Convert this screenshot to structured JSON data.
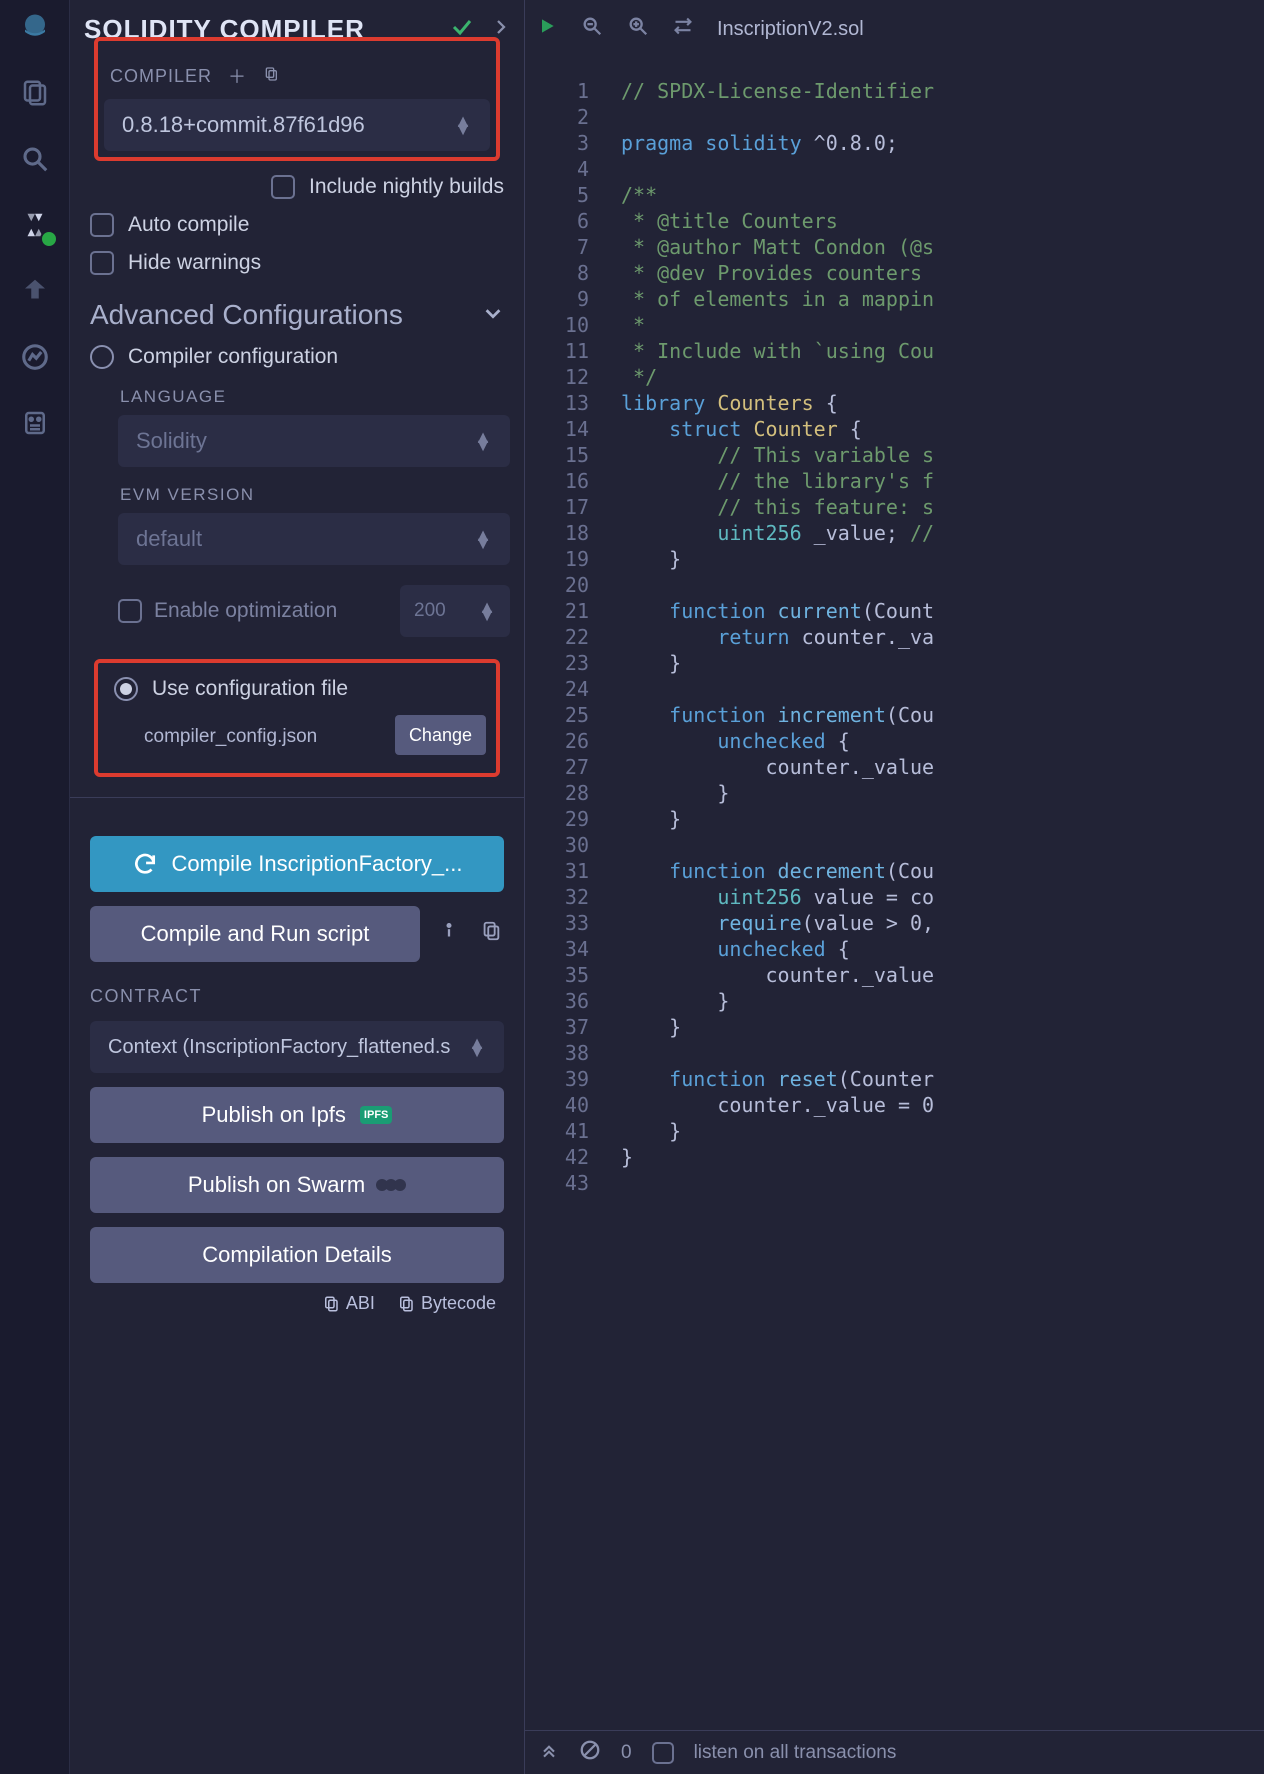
{
  "panel": {
    "title": "SOLIDITY COMPILER",
    "compiler_label": "COMPILER",
    "version": "0.8.18+commit.87f61d96",
    "include_nightly": "Include nightly builds",
    "auto_compile": "Auto compile",
    "hide_warnings": "Hide warnings",
    "advanced": "Advanced Configurations",
    "compiler_config": "Compiler configuration",
    "language_label": "LANGUAGE",
    "language_value": "Solidity",
    "evm_label": "EVM VERSION",
    "evm_value": "default",
    "enable_opt": "Enable optimization",
    "opt_runs": "200",
    "use_config": "Use configuration file",
    "config_file": "compiler_config.json",
    "change_btn": "Change",
    "compile_btn": "Compile InscriptionFactory_...",
    "compile_run_btn": "Compile and Run script",
    "contract_label": "CONTRACT",
    "contract_value": "Context (InscriptionFactory_flattened.s",
    "publish_ipfs": "Publish on Ipfs",
    "publish_swarm": "Publish on Swarm",
    "comp_details": "Compilation Details",
    "abi": "ABI",
    "bytecode": "Bytecode"
  },
  "editor": {
    "filename": "InscriptionV2.sol",
    "status_count": "0",
    "status_listen": "listen on all transactions",
    "lines": [
      {
        "n": 1,
        "h": "<span class='c-cm'>// SPDX-License-Identifier</span>"
      },
      {
        "n": 2,
        "h": ""
      },
      {
        "n": 3,
        "h": "<span class='c-kw'>pragma</span> <span class='c-kw'>solidity</span> ^0.8.0;"
      },
      {
        "n": 4,
        "h": ""
      },
      {
        "n": 5,
        "h": "<span class='c-cm'>/**</span>"
      },
      {
        "n": 6,
        "h": "<span class='c-cm'> * @title Counters</span>"
      },
      {
        "n": 7,
        "h": "<span class='c-cm'> * @author Matt Condon (@s</span>"
      },
      {
        "n": 8,
        "h": "<span class='c-cm'> * @dev Provides counters </span>"
      },
      {
        "n": 9,
        "h": "<span class='c-cm'> * of elements in a mappin</span>"
      },
      {
        "n": 10,
        "h": "<span class='c-cm'> *</span>"
      },
      {
        "n": 11,
        "h": "<span class='c-cm'> * Include with `using Cou</span>"
      },
      {
        "n": 12,
        "h": "<span class='c-cm'> */</span>"
      },
      {
        "n": 13,
        "h": "<span class='c-kw'>library</span> <span class='c-id'>Counters</span> {"
      },
      {
        "n": 14,
        "h": "    <span class='c-kw'>struct</span> <span class='c-id'>Counter</span> {"
      },
      {
        "n": 15,
        "h": "        <span class='c-cm'>// This variable s</span>"
      },
      {
        "n": 16,
        "h": "        <span class='c-cm'>// the library's f</span>"
      },
      {
        "n": 17,
        "h": "        <span class='c-cm'>// this feature: s</span>"
      },
      {
        "n": 18,
        "h": "        <span class='c-ty'>uint256</span> _value; <span class='c-cm'>//</span>"
      },
      {
        "n": 19,
        "h": "    }"
      },
      {
        "n": 20,
        "h": ""
      },
      {
        "n": 21,
        "h": "    <span class='c-kw'>function</span> <span class='c-fn'>current</span>(Count"
      },
      {
        "n": 22,
        "h": "        <span class='c-kw'>return</span> counter._va"
      },
      {
        "n": 23,
        "h": "    }"
      },
      {
        "n": 24,
        "h": ""
      },
      {
        "n": 25,
        "h": "    <span class='c-kw'>function</span> <span class='c-fn'>increment</span>(Cou"
      },
      {
        "n": 26,
        "h": "        <span class='c-kw'>unchecked</span> {"
      },
      {
        "n": 27,
        "h": "            counter._value"
      },
      {
        "n": 28,
        "h": "        }"
      },
      {
        "n": 29,
        "h": "    }"
      },
      {
        "n": 30,
        "h": ""
      },
      {
        "n": 31,
        "h": "    <span class='c-kw'>function</span> <span class='c-fn'>decrement</span>(Cou"
      },
      {
        "n": 32,
        "h": "        <span class='c-ty'>uint256</span> value = co"
      },
      {
        "n": 33,
        "h": "        <span class='c-fn'>require</span>(value &gt; 0,"
      },
      {
        "n": 34,
        "h": "        <span class='c-kw'>unchecked</span> {"
      },
      {
        "n": 35,
        "h": "            counter._value"
      },
      {
        "n": 36,
        "h": "        }"
      },
      {
        "n": 37,
        "h": "    }"
      },
      {
        "n": 38,
        "h": ""
      },
      {
        "n": 39,
        "h": "    <span class='c-kw'>function</span> <span class='c-fn'>reset</span>(Counter"
      },
      {
        "n": 40,
        "h": "        counter._value = 0"
      },
      {
        "n": 41,
        "h": "    }"
      },
      {
        "n": 42,
        "h": "}"
      },
      {
        "n": 43,
        "h": ""
      }
    ]
  }
}
